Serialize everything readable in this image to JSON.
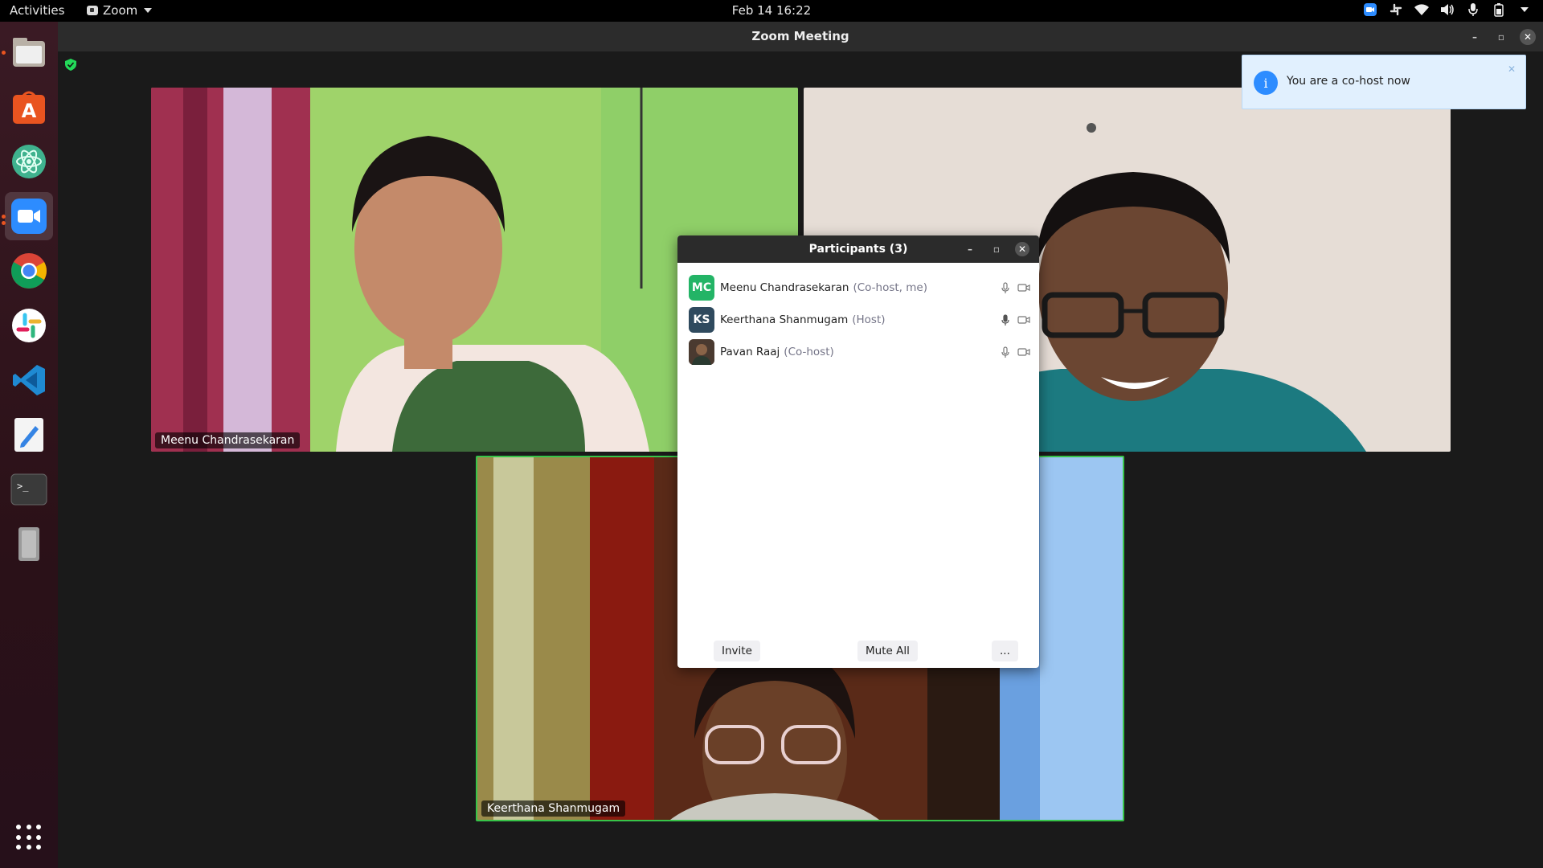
{
  "topbar": {
    "activities": "Activities",
    "app_name": "Zoom",
    "clock": "Feb 14  16:22",
    "tray_icons": [
      "zoom-icon",
      "slack-icon",
      "wifi-icon",
      "volume-icon",
      "mic-icon",
      "battery-icon"
    ]
  },
  "dock": {
    "items": [
      "files-icon",
      "software-center-icon",
      "atom-icon",
      "zoom-icon",
      "chrome-icon",
      "slack-icon",
      "vscode-icon",
      "text-editor-icon",
      "terminal-icon",
      "removable-drive-icon"
    ],
    "active": "zoom-icon",
    "show_apps": "apps-grid-icon"
  },
  "window": {
    "title": "Zoom Meeting",
    "controls": [
      "minimize",
      "maximize",
      "close"
    ]
  },
  "videos": [
    {
      "name": "Meenu Chandrasekaran",
      "active_speaker": false
    },
    {
      "name": "",
      "active_speaker": false
    },
    {
      "name": "Keerthana Shanmugam",
      "active_speaker": true
    }
  ],
  "participants_panel": {
    "title": "Participants (3)",
    "participants": [
      {
        "initials": "MC",
        "name": "Meenu Chandrasekaran",
        "role": "(Co-host, me)",
        "avatar_color": "#23b466"
      },
      {
        "initials": "KS",
        "name": "Keerthana Shanmugam",
        "role": "(Host)",
        "avatar_color": "#2f4a5e"
      },
      {
        "initials": "",
        "name": "Pavan Raaj",
        "role": "(Co-host)",
        "avatar_color": "#5a4a3a"
      }
    ],
    "buttons": {
      "invite": "Invite",
      "mute_all": "Mute All",
      "more": "..."
    }
  },
  "notification": {
    "text": "You are a co-host now",
    "icon": "info-icon"
  },
  "colors": {
    "accent": "#2d8cff",
    "active_speaker_border": "#37c449",
    "ubuntu_orange": "#e95420"
  }
}
